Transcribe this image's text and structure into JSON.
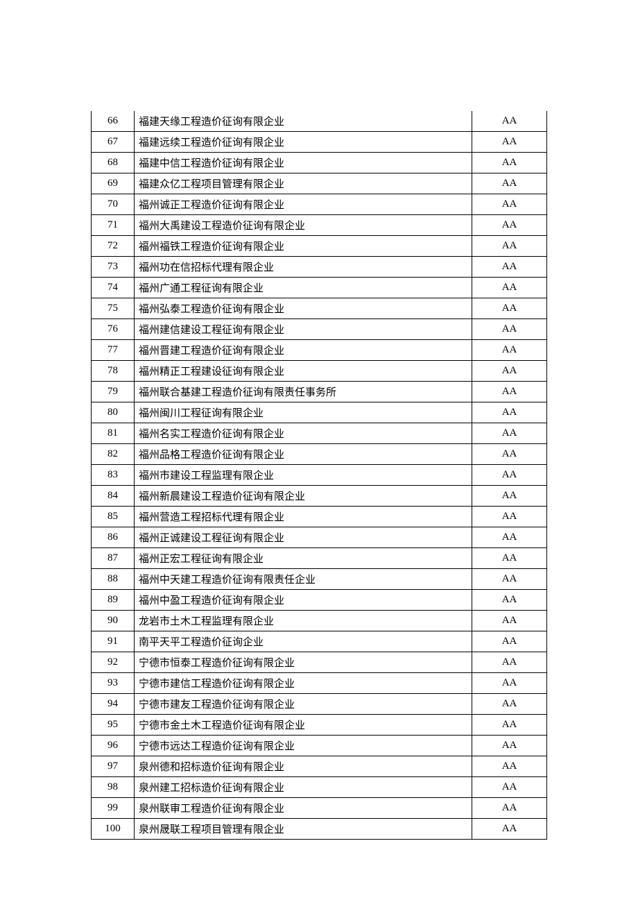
{
  "rows": [
    {
      "num": "66",
      "name": "福建天缘工程造价征询有限企业",
      "rating": "AA"
    },
    {
      "num": "67",
      "name": "福建远续工程造价征询有限企业",
      "rating": "AA"
    },
    {
      "num": "68",
      "name": "福建中信工程造价征询有限企业",
      "rating": "AA"
    },
    {
      "num": "69",
      "name": "福建众亿工程项目管理有限企业",
      "rating": "AA"
    },
    {
      "num": "70",
      "name": "福州诚正工程造价征询有限企业",
      "rating": "AA"
    },
    {
      "num": "71",
      "name": "福州大禹建设工程造价征询有限企业",
      "rating": "AA"
    },
    {
      "num": "72",
      "name": "福州福铁工程造价征询有限企业",
      "rating": "AA"
    },
    {
      "num": "73",
      "name": "福州功在信招标代理有限企业",
      "rating": "AA"
    },
    {
      "num": "74",
      "name": "福州广通工程征询有限企业",
      "rating": "AA"
    },
    {
      "num": "75",
      "name": "福州弘泰工程造价征询有限企业",
      "rating": "AA"
    },
    {
      "num": "76",
      "name": "福州建信建设工程征询有限企业",
      "rating": "AA"
    },
    {
      "num": "77",
      "name": "福州晋建工程造价征询有限企业",
      "rating": "AA"
    },
    {
      "num": "78",
      "name": "福州精正工程建设征询有限企业",
      "rating": "AA"
    },
    {
      "num": "79",
      "name": "福州联合基建工程造价征询有限责任事务所",
      "rating": "AA"
    },
    {
      "num": "80",
      "name": "福州闽川工程征询有限企业",
      "rating": "AA"
    },
    {
      "num": "81",
      "name": "福州名实工程造价征询有限企业",
      "rating": "AA"
    },
    {
      "num": "82",
      "name": "福州品格工程造价征询有限企业",
      "rating": "AA"
    },
    {
      "num": "83",
      "name": "福州市建设工程监理有限企业",
      "rating": "AA"
    },
    {
      "num": "84",
      "name": "福州新晨建设工程造价征询有限企业",
      "rating": "AA"
    },
    {
      "num": "85",
      "name": "福州营造工程招标代理有限企业",
      "rating": "AA"
    },
    {
      "num": "86",
      "name": "福州正诚建设工程征询有限企业",
      "rating": "AA"
    },
    {
      "num": "87",
      "name": "福州正宏工程征询有限企业",
      "rating": "AA"
    },
    {
      "num": "88",
      "name": "福州中天建工程造价征询有限责任企业",
      "rating": "AA"
    },
    {
      "num": "89",
      "name": "福州中盈工程造价征询有限企业",
      "rating": "AA"
    },
    {
      "num": "90",
      "name": "龙岩市土木工程监理有限企业",
      "rating": "AA"
    },
    {
      "num": "91",
      "name": "南平天平工程造价征询企业",
      "rating": "AA"
    },
    {
      "num": "92",
      "name": "宁德市恒泰工程造价征询有限企业",
      "rating": "AA"
    },
    {
      "num": "93",
      "name": "宁德市建信工程造价征询有限企业",
      "rating": "AA"
    },
    {
      "num": "94",
      "name": "宁德市建友工程造价征询有限企业",
      "rating": "AA"
    },
    {
      "num": "95",
      "name": "宁德市金土木工程造价征询有限企业",
      "rating": "AA"
    },
    {
      "num": "96",
      "name": "宁德市远达工程造价征询有限企业",
      "rating": "AA"
    },
    {
      "num": "97",
      "name": "泉州德和招标造价征询有限企业",
      "rating": "AA"
    },
    {
      "num": "98",
      "name": "泉州建工招标造价征询有限企业",
      "rating": "AA"
    },
    {
      "num": "99",
      "name": "泉州联审工程造价征询有限企业",
      "rating": "AA"
    },
    {
      "num": "100",
      "name": "泉州晟联工程项目管理有限企业",
      "rating": "AA"
    }
  ]
}
